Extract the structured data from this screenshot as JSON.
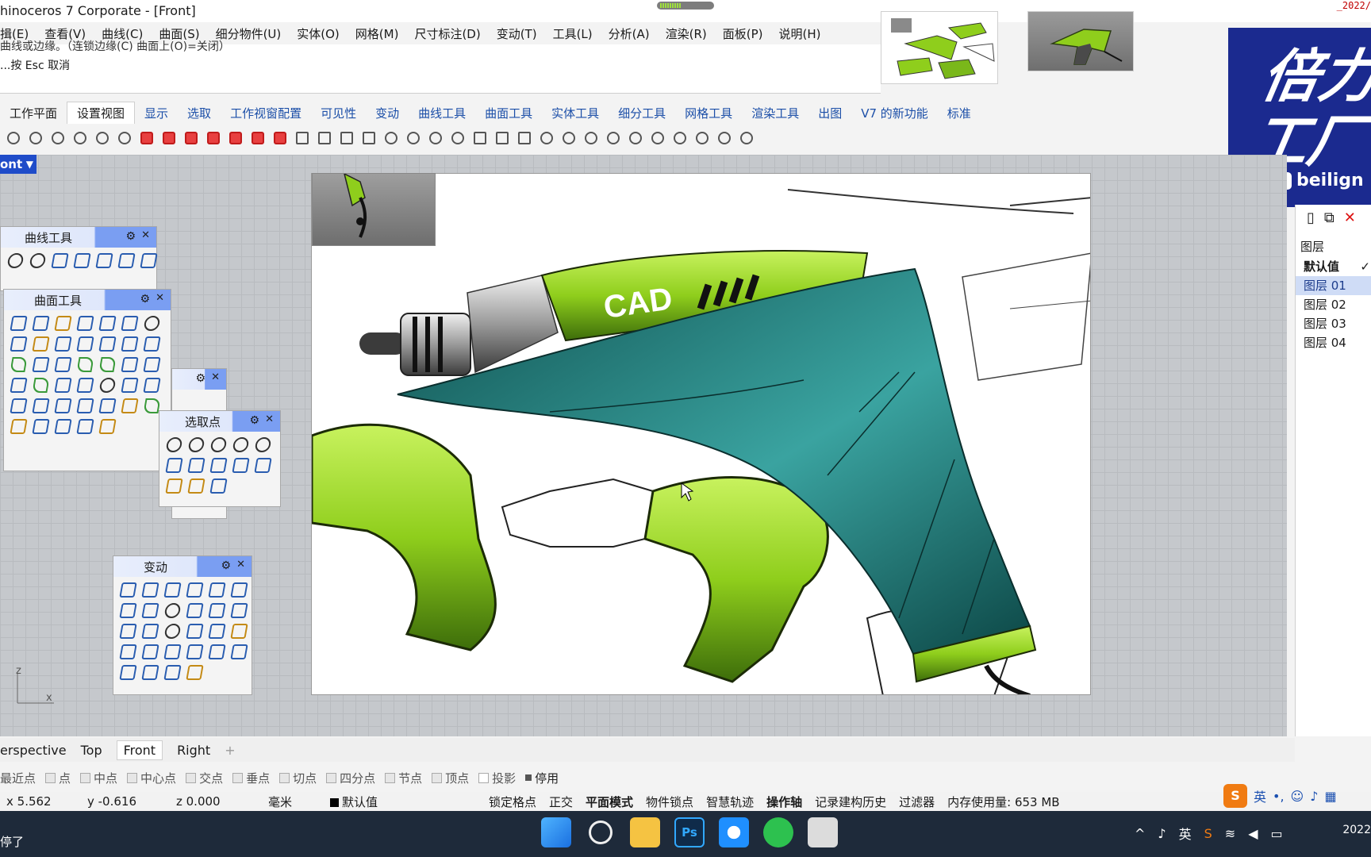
{
  "window": {
    "title": "hinoceros 7 Corporate - [Front]",
    "date_red": "_2022/"
  },
  "menu": [
    "揖(E)",
    "查看(V)",
    "曲线(C)",
    "曲面(S)",
    "细分物件(U)",
    "实体(O)",
    "网格(M)",
    "尺寸标注(D)",
    "变动(T)",
    "工具(L)",
    "分析(A)",
    "渲染(R)",
    "面板(P)",
    "说明(H)"
  ],
  "command": {
    "line1": "曲线或边缘。（连锁边缘(C) 曲面上(O)=关闭）",
    "line2": "...按 Esc 取消",
    "input": ""
  },
  "tabs": [
    "工作平面",
    "设置视图",
    "显示",
    "选取",
    "工作视窗配置",
    "可见性",
    "变动",
    "曲线工具",
    "曲面工具",
    "实体工具",
    "细分工具",
    "网格工具",
    "渲染工具",
    "出图",
    "V7 的新功能",
    "标准"
  ],
  "active_tab_index": 1,
  "viewport": {
    "label": "ont",
    "axis_z": "z",
    "axis_x": "x"
  },
  "image": {
    "text": "CAD"
  },
  "panels": {
    "curve_tools": "曲线工具",
    "surface_tools": "曲面工具",
    "select_points": "选取点",
    "transform": "变动"
  },
  "brand": {
    "big": "倍力\n工厂",
    "wechat": "beilign"
  },
  "layers": {
    "header": "图层",
    "items": [
      {
        "name": "默认值",
        "check": "✓"
      },
      {
        "name": "图层 01"
      },
      {
        "name": "图层 02"
      },
      {
        "name": "图层 03"
      },
      {
        "name": "图层 04"
      }
    ]
  },
  "viewport_tabs": [
    "erspective",
    "Top",
    "Front",
    "Right",
    "+"
  ],
  "active_viewport_tab": "Front",
  "osnaps": [
    "最近点",
    "点",
    "中点",
    "中心点",
    "交点",
    "垂点",
    "切点",
    "四分点",
    "节点",
    "顶点",
    "投影",
    "停用"
  ],
  "status": {
    "x": "x 5.562",
    "y": "y -0.616",
    "z": "z 0.000",
    "unit": "毫米",
    "layer": "默认值",
    "grid_snap": "锁定格点",
    "ortho": "正交",
    "planar": "平面模式",
    "osnap": "物件锁点",
    "smarttrack": "智慧轨迹",
    "gumball": "操作轴",
    "history": "记录建构历史",
    "filter": "过滤器",
    "memory": "内存使用量: 653 MB"
  },
  "ime": {
    "lang": "英"
  },
  "taskbar": {
    "left_text": "停了",
    "tray_lang": "英",
    "clock": "2022"
  },
  "colors": {
    "accent_blue": "#1f4cc9",
    "brand_navy": "#1b2a8f",
    "drill_teal": "#1f6e6a",
    "drill_green": "#8fce1c"
  }
}
